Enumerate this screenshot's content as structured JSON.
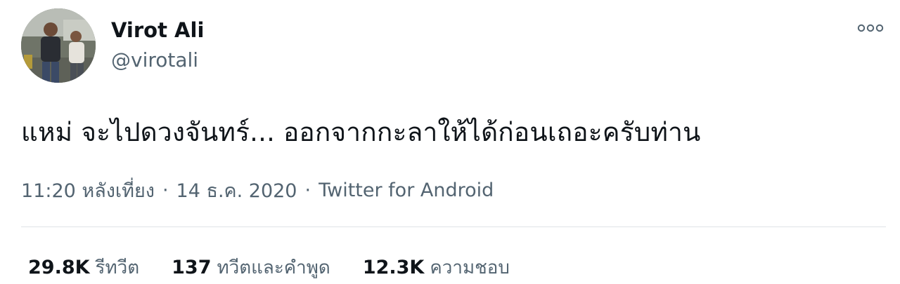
{
  "user": {
    "display_name": "Virot Ali",
    "handle": "@virotali"
  },
  "icons": {
    "more": "more-options-icon",
    "avatar": "profile-photo"
  },
  "tweet": {
    "text": "แหม่ จะไปดวงจันทร์... ออกจากกะลาให้ได้ก่อนเถอะครับท่าน"
  },
  "meta": {
    "time": "11:20 หลังเที่ยง",
    "separator_1": "·",
    "date": "14 ธ.ค. 2020",
    "separator_2": "·",
    "source": "Twitter for Android"
  },
  "stats": [
    {
      "count": "29.8K",
      "label": "รีทวีต"
    },
    {
      "count": "137",
      "label": "ทวีตและคำพูด"
    },
    {
      "count": "12.3K",
      "label": "ความชอบ"
    }
  ],
  "colors": {
    "text_primary": "#0f1419",
    "text_secondary": "#536471",
    "divider": "#dfe3e6",
    "more_icon": "#536471"
  }
}
